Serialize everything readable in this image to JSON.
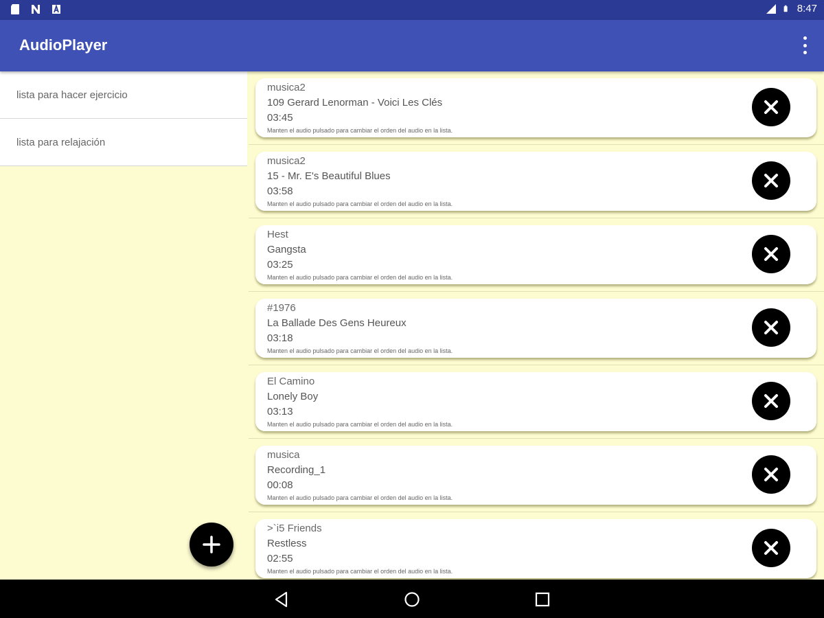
{
  "status_bar": {
    "time": "8:47",
    "icons": [
      "sd-card-icon",
      "n-notification-icon",
      "a-notification-icon",
      "signal-icon",
      "battery-icon"
    ]
  },
  "app_bar": {
    "title": "AudioPlayer",
    "overflow_icon": "more-vert-icon"
  },
  "playlists": [
    {
      "label": "lista para hacer ejercicio"
    },
    {
      "label": "lista para relajación"
    }
  ],
  "fab": {
    "icon": "plus-icon"
  },
  "tracks": [
    {
      "artist": "musica2",
      "title": "109 Gerard Lenorman - Voici Les Clés",
      "duration": "03:45",
      "hint": "Manten el audio pulsado para cambiar el orden del audio en la lista."
    },
    {
      "artist": "musica2",
      "title": "15 - Mr. E's Beautiful Blues",
      "duration": "03:58",
      "hint": "Manten el audio pulsado para cambiar el orden del audio en la lista."
    },
    {
      "artist": "Hest",
      "title": "Gangsta",
      "duration": "03:25",
      "hint": "Manten el audio pulsado para cambiar el orden del audio en la lista."
    },
    {
      "artist": "#1976",
      "title": "La Ballade Des Gens Heureux",
      "duration": "03:18",
      "hint": "Manten el audio pulsado para cambiar el orden del audio en la lista."
    },
    {
      "artist": "El Camino",
      "title": "Lonely Boy",
      "duration": "03:13",
      "hint": "Manten el audio pulsado para cambiar el orden del audio en la lista."
    },
    {
      "artist": "musica",
      "title": "Recording_1",
      "duration": "00:08",
      "hint": "Manten el audio pulsado para cambiar el orden del audio en la lista."
    },
    {
      "artist": ">`i5 Friends",
      "title": "Restless",
      "duration": "02:55",
      "hint": "Manten el audio pulsado para cambiar el orden del audio en la lista."
    }
  ],
  "nav_bar": {
    "buttons": [
      "back-icon",
      "home-icon",
      "recents-icon"
    ]
  },
  "colors": {
    "status_bar": "#2b3a94",
    "app_bar": "#3f51b5",
    "background": "#fdfbd0",
    "card": "#ffffff",
    "button": "#000000"
  }
}
